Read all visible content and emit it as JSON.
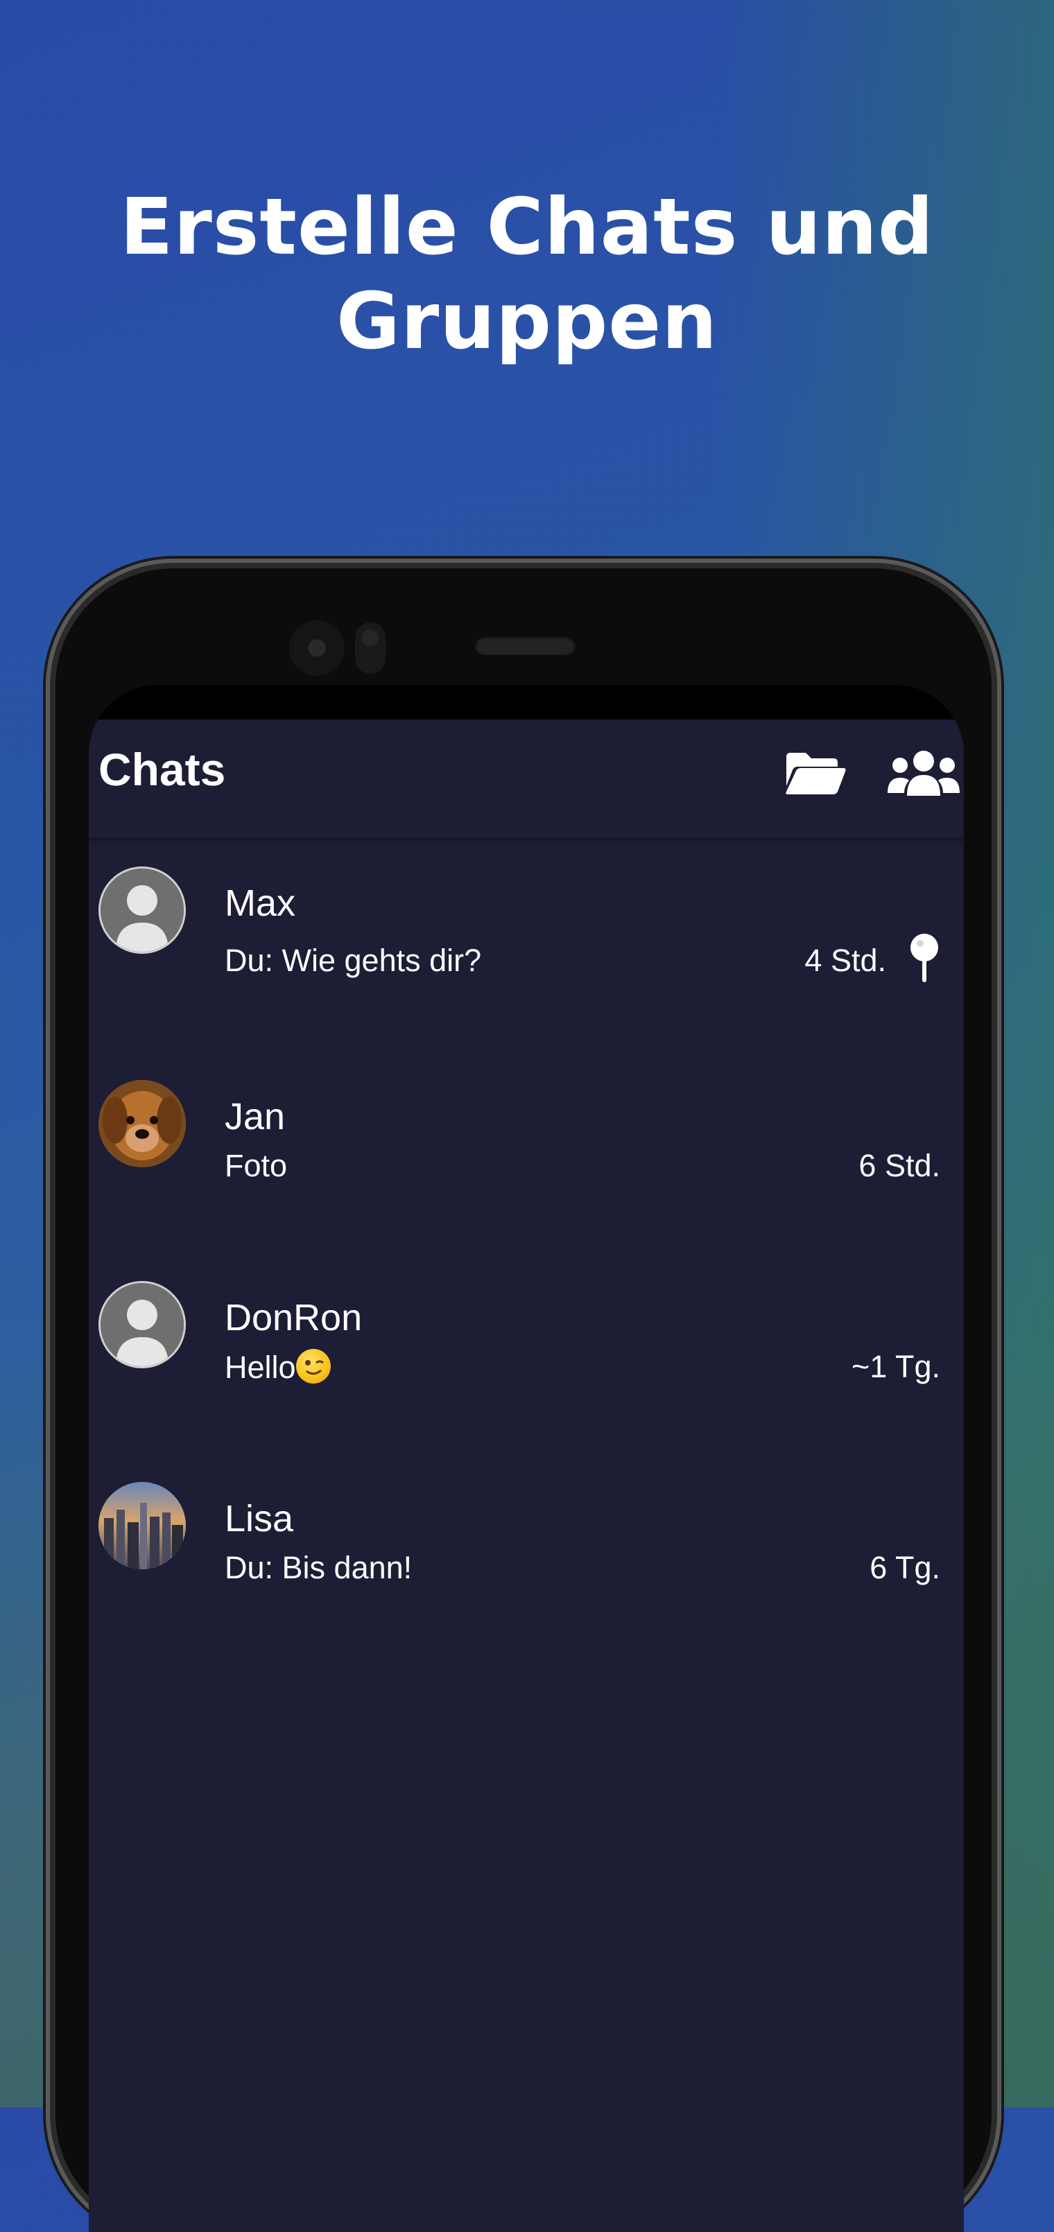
{
  "headline": {
    "line1": "Erstelle Chats und",
    "line2": "Gruppen"
  },
  "app": {
    "title": "Chats",
    "icons": {
      "folder": "folder-open-icon",
      "groups": "users-group-icon"
    }
  },
  "chats": [
    {
      "name": "Max",
      "message": "Du: Wie gehts dir?",
      "time": "4 Std.",
      "pinned": true,
      "avatar": "default-avatar"
    },
    {
      "name": "Jan",
      "message": "Foto",
      "time": "6 Std.",
      "pinned": false,
      "avatar": "dog-photo"
    },
    {
      "name": "DonRon",
      "message": "Hello",
      "time": "~1 Tg.",
      "pinned": false,
      "avatar": "default-avatar",
      "emoji": "wink-emoji"
    },
    {
      "name": "Lisa",
      "message": "Du: Bis dann!",
      "time": "6 Tg.",
      "pinned": false,
      "avatar": "city-photo"
    }
  ],
  "colors": {
    "app_background": "#1d1d35",
    "text": "#ffffff"
  }
}
